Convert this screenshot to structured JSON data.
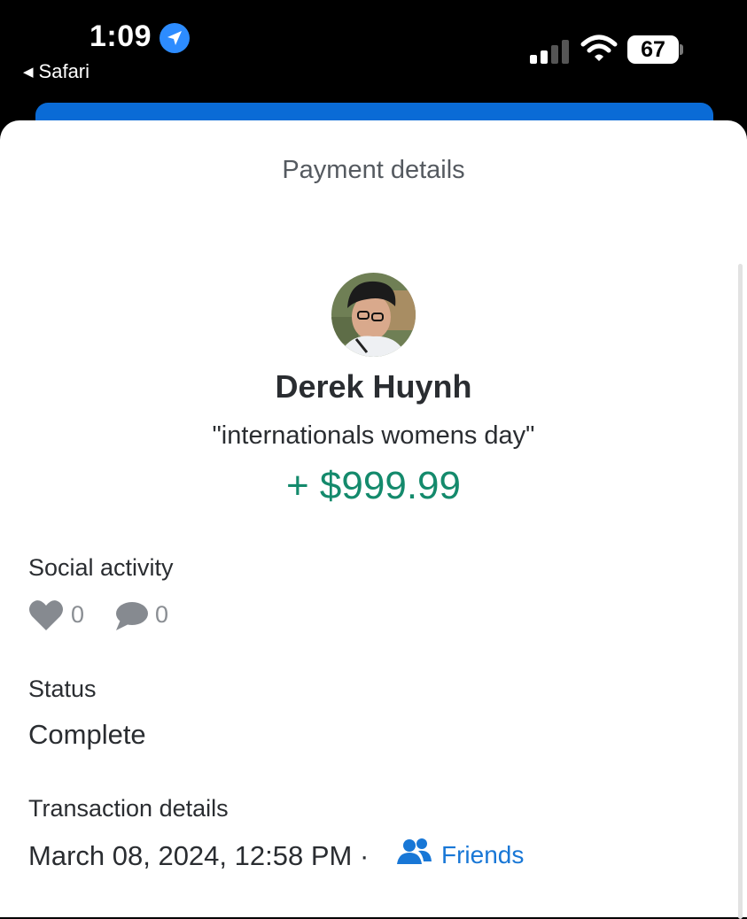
{
  "status_bar": {
    "time": "1:09",
    "back_label": "Safari",
    "battery": "67",
    "icons": [
      "location-arrow-icon",
      "signal-icon",
      "wifi-icon",
      "battery-icon"
    ]
  },
  "sheet": {
    "title": "Payment details"
  },
  "payment": {
    "name": "Derek Huynh",
    "note": "\"internationals womens day\"",
    "amount": "+ $999.99"
  },
  "social": {
    "label": "Social activity",
    "likes": "0",
    "comments": "0"
  },
  "status": {
    "label": "Status",
    "value": "Complete"
  },
  "transaction": {
    "label": "Transaction details",
    "datetime": "March 08, 2024, 12:58 PM ·",
    "audience": "Friends"
  },
  "colors": {
    "amount_green": "#148a6c",
    "link_blue": "#1877d6",
    "header_blue": "#0a6bd6"
  }
}
